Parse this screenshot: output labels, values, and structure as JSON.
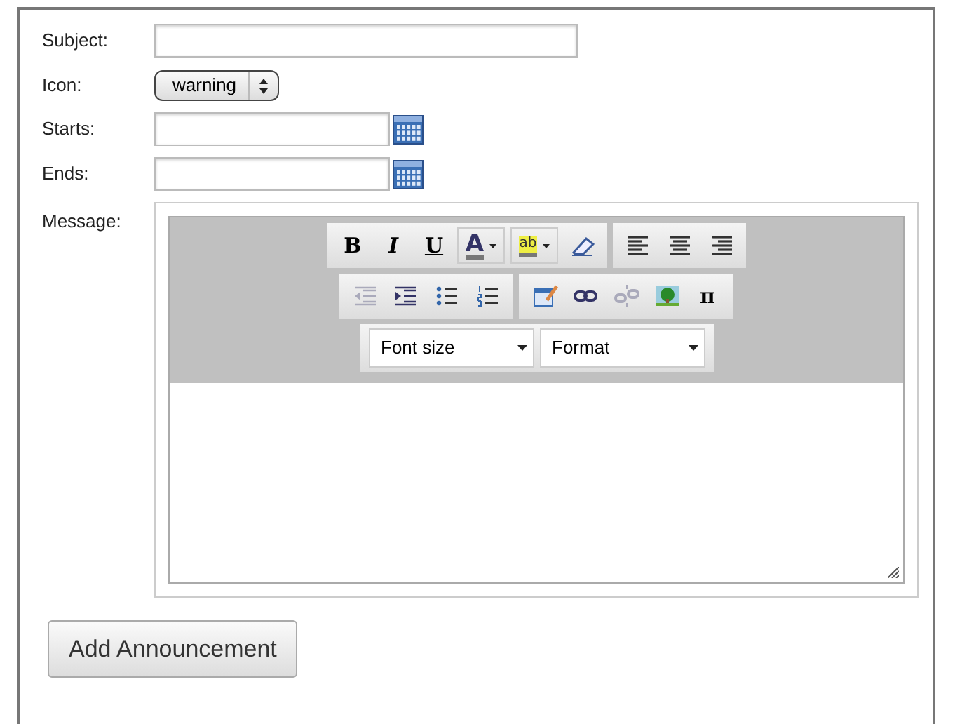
{
  "fields": [
    {
      "label": "Subject:",
      "kind": "text"
    },
    {
      "label": "Icon:",
      "kind": "select",
      "value": "warning"
    },
    {
      "label": "Starts:",
      "kind": "date"
    },
    {
      "label": "Ends:",
      "kind": "date"
    }
  ],
  "message": {
    "label": "Message:",
    "toolbar": [
      [
        [
          {
            "kind": "bold",
            "label": "B"
          },
          {
            "kind": "italic",
            "label": "I"
          },
          {
            "kind": "underline",
            "label": "U"
          },
          {
            "kind": "text-color",
            "label": "A"
          },
          {
            "kind": "highlight",
            "label": "ab"
          },
          {
            "kind": "eraser"
          }
        ],
        [
          {
            "kind": "align-left"
          },
          {
            "kind": "align-center"
          },
          {
            "kind": "align-right"
          }
        ]
      ],
      [
        [
          {
            "kind": "outdent",
            "disabled": true
          },
          {
            "kind": "indent",
            "disabled": false
          },
          {
            "kind": "bullets"
          },
          {
            "kind": "numbers"
          }
        ],
        [
          {
            "kind": "table"
          },
          {
            "kind": "link",
            "disabled": false
          },
          {
            "kind": "unlink",
            "disabled": true
          },
          {
            "kind": "image"
          },
          {
            "kind": "symbol",
            "label": "π"
          }
        ]
      ],
      [
        [
          {
            "kind": "dropdown",
            "label": "Font size"
          },
          {
            "kind": "dropdown",
            "label": "Format"
          }
        ]
      ]
    ]
  },
  "submit": "Add Announcement"
}
